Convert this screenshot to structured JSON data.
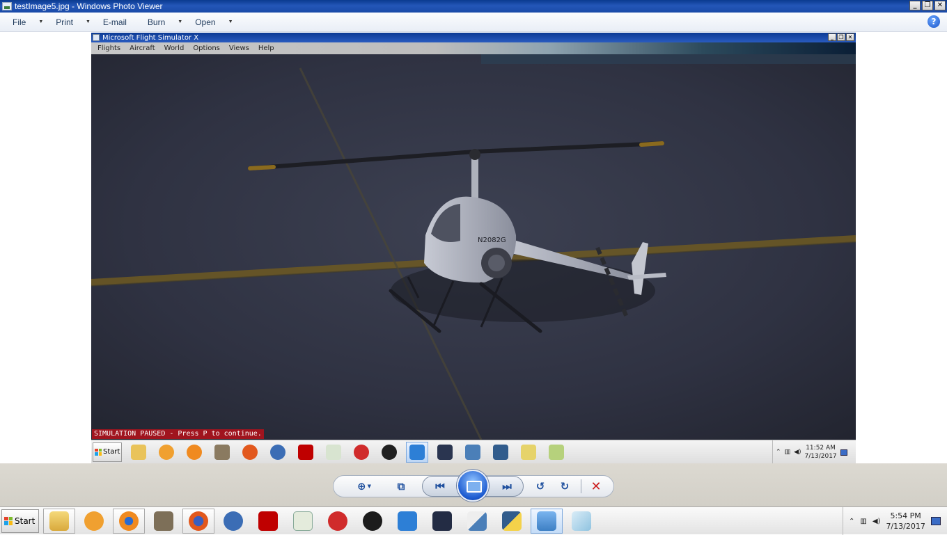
{
  "viewer": {
    "title": "testImage5.jpg - Windows Photo Viewer",
    "menus": [
      {
        "label": "File"
      },
      {
        "label": "Print"
      },
      {
        "label": "E-mail"
      },
      {
        "label": "Burn"
      },
      {
        "label": "Open"
      }
    ],
    "help_icon": "question-icon",
    "window_buttons": [
      "_",
      "❐",
      "✕"
    ]
  },
  "fsx": {
    "title": "Microsoft Flight Simulator X",
    "menus": [
      "Flights",
      "Aircraft",
      "World",
      "Options",
      "Views",
      "Help"
    ],
    "status": "SIMULATION PAUSED - Press P to continue.",
    "start_label": "Start",
    "clock_time": "11:52 AM",
    "clock_date": "7/13/2017",
    "helicopter_tail_number": "N2082G"
  },
  "controls": {
    "zoom": "zoom-icon",
    "actual_size": "actual-size-icon",
    "previous": "previous-icon",
    "slideshow": "slideshow-icon",
    "next": "next-icon",
    "rotate_ccw": "rotate-counterclockwise-icon",
    "rotate_cw": "rotate-clockwise-icon",
    "delete": "delete-icon"
  },
  "taskbar": {
    "start_label": "Start",
    "clock_time": "5:54 PM",
    "clock_date": "7/13/2017",
    "apps": [
      "windows-explorer",
      "media-player",
      "blender",
      "gimp",
      "firefox",
      "thunderbird",
      "filezilla",
      "notepad-plus",
      "ccleaner",
      "obs",
      "flight-simulator",
      "unity",
      "python-idle",
      "python",
      "photo-viewer",
      "paint"
    ]
  },
  "colors": {
    "title_blue": "#1a4aa8",
    "paused_red": "#a0141e",
    "delete_red": "#cc1d1d"
  }
}
